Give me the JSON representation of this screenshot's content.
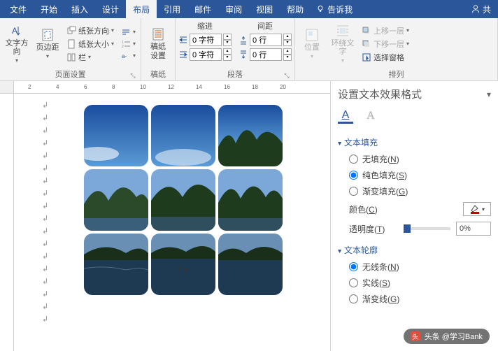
{
  "tabs": {
    "file": "文件",
    "home": "开始",
    "insert": "插入",
    "design": "设计",
    "layout": "布局",
    "references": "引用",
    "mailings": "邮件",
    "review": "审阅",
    "view": "视图",
    "help": "帮助",
    "tellme": "告诉我",
    "share": "共"
  },
  "ribbon": {
    "textDirection": "文字方向",
    "margins": "页边距",
    "orientation": "纸张方向",
    "size": "纸张大小",
    "columns": "栏",
    "breaks": "分隔符",
    "lineNumbers": "行号",
    "hyphenation": "断字",
    "pageSetupGroup": "页面设置",
    "manuscript": "稿纸\n设置",
    "manuscriptGroup": "稿纸",
    "indentHdr": "缩进",
    "spacingHdr": "间距",
    "indentLeft": "0 字符",
    "indentRight": "0 字符",
    "spacingBefore": "0 行",
    "spacingAfter": "0 行",
    "paragraphGroup": "段落",
    "position": "位置",
    "wrap": "环绕文字",
    "bringForward": "上移一层",
    "sendBackward": "下移一层",
    "selectionPane": "选择窗格",
    "arrangeGroup": "排列"
  },
  "ruler": {
    "m2": "2",
    "m4": "4",
    "m6": "6",
    "m8": "8",
    "m10": "10",
    "m12": "12",
    "m14": "14",
    "m16": "16",
    "m18": "18",
    "m20": "20"
  },
  "pane": {
    "title": "设置文本效果格式",
    "fillHdr": "文本填充",
    "noFill": "无填充",
    "noFillKey": "N",
    "solidFill": "纯色填充",
    "solidFillKey": "S",
    "gradFill": "渐变填充",
    "gradFillKey": "G",
    "colorLabel": "颜色",
    "colorKey": "C",
    "transparency": "透明度",
    "transparencyKey": "T",
    "transparencyVal": "0%",
    "outlineHdr": "文本轮廓",
    "noLine": "无线条",
    "noLineKey": "N",
    "solidLine": "实线",
    "solidLineKey": "S",
    "gradLine": "渐变线",
    "gradLineKey": "G"
  },
  "watermark": {
    "prefix": "头条",
    "author": "@学习Bank"
  }
}
